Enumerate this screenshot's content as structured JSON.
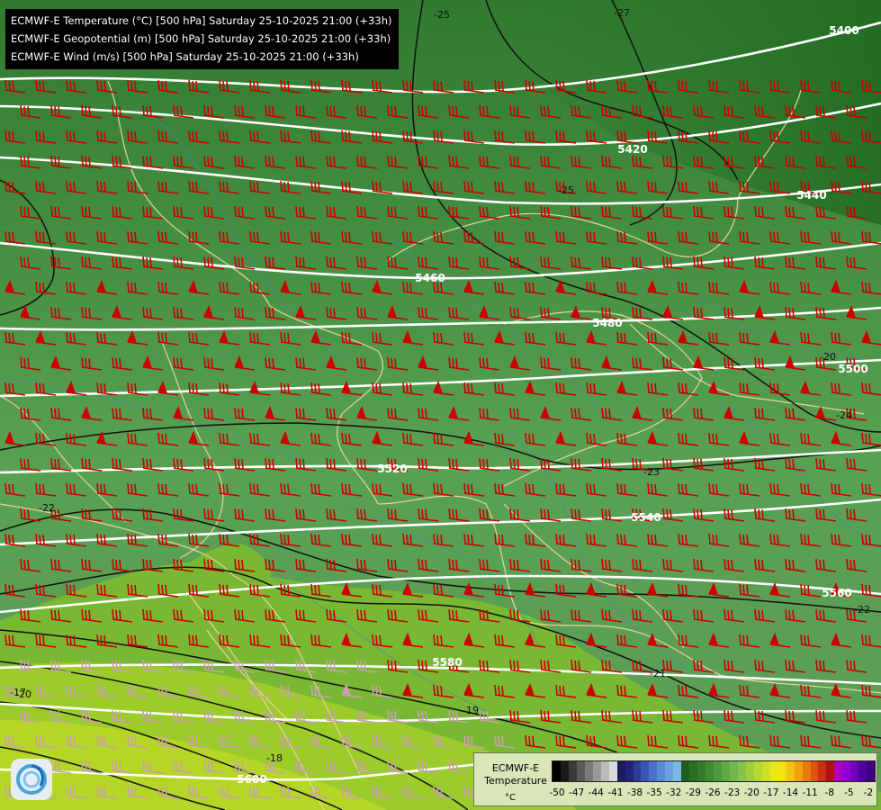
{
  "titles": [
    "ECMWF-E Temperature (°C) [500 hPa] Saturday 25-10-2025 21:00 (+33h)",
    "ECMWF-E Geopotential (m) [500 hPa] Saturday 25-10-2025 21:00 (+33h)",
    "ECMWF-E Wind (m/s) [500 hPa] Saturday 25-10-2025 21:00 (+33h)"
  ],
  "geopotential_labels": [
    "5400",
    "5420",
    "5440",
    "5460",
    "5480",
    "5500",
    "5520",
    "5540",
    "5560",
    "5580",
    "5600"
  ],
  "temperature_labels": [
    "-25",
    "-27",
    "-25",
    "-24",
    "-23",
    "-22",
    "-22",
    "-21",
    "-20",
    "-19",
    "-18",
    "-17",
    "-20"
  ],
  "legend": {
    "title_line1": "ECMWF-E",
    "title_line2": "Temperature",
    "unit": "°C",
    "ticks": [
      "-50",
      "-47",
      "-44",
      "-41",
      "-38",
      "-35",
      "-32",
      "-29",
      "-26",
      "-23",
      "-20",
      "-17",
      "-14",
      "-11",
      "-8",
      "-5",
      "-2"
    ],
    "colors": [
      "#000000",
      "#1a1a1a",
      "#3a3a3a",
      "#5a5a5a",
      "#7a7a7a",
      "#9a9a9a",
      "#bababa",
      "#dadada",
      "#1a1a60",
      "#23237c",
      "#2e3c9a",
      "#3c55b5",
      "#4a70c8",
      "#5a8ad5",
      "#6aa2dd",
      "#7ab8e5",
      "#1e5e1e",
      "#2a6e22",
      "#357c2a",
      "#408a33",
      "#4f9a3d",
      "#5faa45",
      "#70b84c",
      "#85c44a",
      "#9ccf3c",
      "#b5d930",
      "#cfe124",
      "#e8e81a",
      "#f5e010",
      "#f5c410",
      "#f0a010",
      "#e87a10",
      "#dc5510",
      "#c83010",
      "#b01010",
      "#b000c0",
      "#9000d0",
      "#7000c0",
      "#5000a0",
      "#400080"
    ]
  },
  "colors": {
    "wind_barb": "#cc0000",
    "wind_barb_south": "#c8a0b0",
    "geopotential_contour": "#ffffff",
    "temperature_contour": "#111111",
    "border": "#e8d49a",
    "river": "#4a84c0"
  }
}
